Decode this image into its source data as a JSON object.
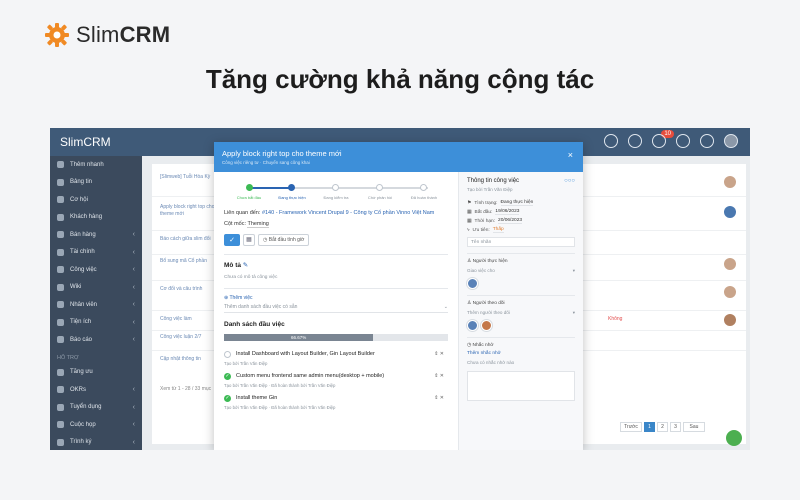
{
  "brand": {
    "name_light": "Slim",
    "name_bold": "CRM",
    "accent": "#f08a24"
  },
  "headline": "Tăng cường khả năng cộng tác",
  "app": {
    "logo": "SlimCRM",
    "notification_count": "10",
    "sidebar": {
      "items": [
        {
          "label": "Thêm nhanh",
          "icon": "plus-icon"
        },
        {
          "label": "Bảng tin",
          "icon": "home-icon"
        },
        {
          "label": "Cơ hội",
          "icon": "phone-icon"
        },
        {
          "label": "Khách hàng",
          "icon": "users-icon"
        },
        {
          "label": "Bán hàng",
          "icon": "cart-icon"
        },
        {
          "label": "Tài chính",
          "icon": "money-icon"
        },
        {
          "label": "Công việc",
          "icon": "tasks-icon"
        },
        {
          "label": "Wiki",
          "icon": "book-icon"
        },
        {
          "label": "Nhân viên",
          "icon": "staff-icon"
        },
        {
          "label": "Tiện ích",
          "icon": "tools-icon"
        },
        {
          "label": "Báo cáo",
          "icon": "chart-icon"
        }
      ],
      "section_label": "HỖ TRỢ",
      "support_items": [
        {
          "label": "Tăng ưu",
          "icon": "bag-icon"
        },
        {
          "label": "OKRs",
          "icon": "target-icon"
        },
        {
          "label": "Tuyển dụng",
          "icon": "hire-icon"
        },
        {
          "label": "Cuộc họp",
          "icon": "meeting-icon"
        },
        {
          "label": "Trình ký",
          "icon": "sign-icon"
        }
      ]
    },
    "background_rows": [
      "[Slimweb] Tuỗi Hòa Kỳ",
      "Apply block right top cho theme mới",
      "Báo cách giữa slim đổi",
      "Bổ sung mã Cổ phần",
      "Cơ đổi và câu trình",
      "Công việc làm",
      "Công việc luận 2/7",
      "Cập nhật thông tin",
      "Xem từ 1 - 28 / 33 mục"
    ],
    "red_label": "Không",
    "pager": [
      "Trước",
      "1",
      "2",
      "3",
      "Sau"
    ]
  },
  "modal": {
    "title": "Apply block right top cho theme mới",
    "subtitle": "Công việc riêng tư · Chuyển sang công khai",
    "close": "×",
    "steps": [
      "Chưa bắt đầu",
      "Đang thực hiện",
      "Đang kiểm tra",
      "Chờ phản hồi",
      "Đã hoàn thành"
    ],
    "related_label": "Liên quan đến:",
    "related_link": "#140 - Framework Vincent Drupal 9 - Công ty Cổ phần Vinno Việt Nam",
    "milestone_label": "Cột mốc:",
    "milestone_value": "Theming",
    "timer_label": "Bắt đầu tính giờ",
    "description_title": "Mô tả",
    "description_empty": "Chưa có mô tả công việc",
    "add_checklist_link": "Thêm việc",
    "add_checklist_placeholder": "Thêm danh sách đầu việc có sẵn",
    "checklist_title": "Danh sách đầu việc",
    "progress_text": "66.67%",
    "progress_value": 0.6667,
    "todos": [
      {
        "name": "Install Dashboard with Layout Builder, Gin Layout Builder",
        "meta": "Tạo bởi Trần Văn Điệp",
        "done": false
      },
      {
        "name": "Custom menu frontend same admin menu(desktop + mobile)",
        "meta": "Tạo bởi Trần Văn Điệp · Đã hoàn thành bởi Trần Văn Điệp",
        "done": true
      },
      {
        "name": "Install theme Gin",
        "meta": "Tạo bởi Trần Văn Điệp · Đã hoàn thành bởi Trần Văn Điệp",
        "done": true
      }
    ],
    "right": {
      "title": "Thông tin công việc",
      "created_by": "Tạo bởi Trần Văn Điệp",
      "status_label": "Tình trạng:",
      "status_value": "Đang thực hiện",
      "start_label": "Bắt đầu:",
      "start_value": "19/06/2023",
      "due_label": "Thời hạn:",
      "due_value": "20/06/2023",
      "priority_label": "Ưu tiên:",
      "priority_value": "Thấp",
      "tags_placeholder": "Tên nhãn",
      "assignee_label": "Người thực hiện",
      "assignee_select": "Giao việc cho",
      "follower_label": "Người theo dõi",
      "follower_select": "Thêm người theo dõi",
      "reminder_label": "Nhắc nhở",
      "reminder_link": "Thêm nhắc nhở",
      "reminder_empty": "Chưa có nhắc nhở nào"
    }
  }
}
